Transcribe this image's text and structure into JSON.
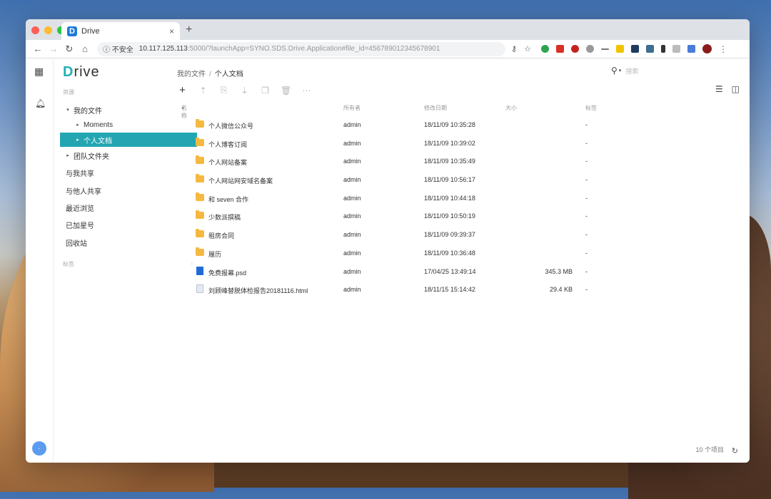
{
  "browser": {
    "tab_title": "Drive",
    "new_tab": "+",
    "tab_close": "×",
    "security": "不安全",
    "url_host": "10.117.125.113",
    "url_rest": ":5000/?launchApp=SYNO.SDS.Drive.Application#file_id=456789012345678901",
    "icons": [
      "back-icon",
      "forward-icon",
      "reload-icon",
      "home-icon",
      "info-icon",
      "key-icon",
      "star-icon"
    ]
  },
  "rail": {
    "avatar_text": "·"
  },
  "sidebar": {
    "brand_d": "D",
    "brand_rest": "rive",
    "section_nav": "资源",
    "items": [
      {
        "label": "我的文件",
        "caret": "▾"
      },
      {
        "label": "Moments",
        "caret": "▸"
      },
      {
        "label": "个人文档",
        "caret": "▸"
      },
      {
        "label": "团队文件夹",
        "caret": "▸"
      },
      {
        "label": "与我共享",
        "caret": ""
      },
      {
        "label": "与他人共享",
        "caret": ""
      },
      {
        "label": "最近浏览",
        "caret": ""
      },
      {
        "label": "已加星号",
        "caret": ""
      },
      {
        "label": "回收站",
        "caret": ""
      }
    ],
    "section_labels": "标签"
  },
  "main": {
    "breadcrumb": [
      "我的文件",
      "个人文档"
    ],
    "crumb_sep": "/",
    "search_placeholder": "搜索",
    "add_label": "+",
    "columns": {
      "name": "名称",
      "sort": "▴",
      "owner": "所有者",
      "modified": "修改日期",
      "size": "大小",
      "tags": "标签"
    },
    "rows": [
      {
        "name": "个人微信公众号",
        "type": "folder",
        "owner": "admin",
        "modified": "18/11/09 10:35:28",
        "size": "",
        "tags": "-"
      },
      {
        "name": "个人博客订阅",
        "type": "folder",
        "owner": "admin",
        "modified": "18/11/09 10:39:02",
        "size": "",
        "tags": "-"
      },
      {
        "name": "个人网站备案",
        "type": "folder",
        "owner": "admin",
        "modified": "18/11/09 10:35:49",
        "size": "",
        "tags": "-"
      },
      {
        "name": "个人网站网安域名备案",
        "type": "folder",
        "owner": "admin",
        "modified": "18/11/09 10:56:17",
        "size": "",
        "tags": "-"
      },
      {
        "name": "和 seven 合作",
        "type": "folder",
        "owner": "admin",
        "modified": "18/11/09 10:44:18",
        "size": "",
        "tags": "-"
      },
      {
        "name": "少数派撰稿",
        "type": "folder",
        "owner": "admin",
        "modified": "18/11/09 10:50:19",
        "size": "",
        "tags": "-"
      },
      {
        "name": "租房合同",
        "type": "folder",
        "owner": "admin",
        "modified": "18/11/09 09:39:37",
        "size": "",
        "tags": "-"
      },
      {
        "name": "履历",
        "type": "folder",
        "owner": "admin",
        "modified": "18/11/09 10:36:48",
        "size": "",
        "tags": "-"
      },
      {
        "name": "免费报幕.psd",
        "type": "psd",
        "owner": "admin",
        "modified": "17/04/25 13:49:14",
        "size": "345.3 MB",
        "tags": "-"
      },
      {
        "name": "刘顾峰替脱体检报告20181116.html",
        "type": "html",
        "owner": "admin",
        "modified": "18/11/15 15:14:42",
        "size": "29.4 KB",
        "tags": "-"
      }
    ],
    "footer_count": "10 个项目"
  },
  "colors": {
    "accent": "#23a6b2",
    "folder": "#f5b841"
  }
}
